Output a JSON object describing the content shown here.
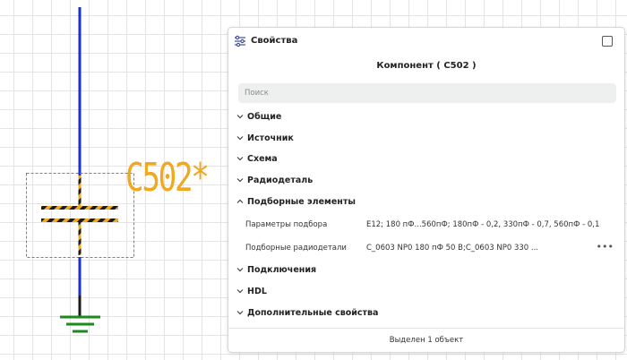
{
  "schematic": {
    "component_ref": "C502*",
    "colors": {
      "wire": "#1a2fd6",
      "lead": "#1a1a1a",
      "label": "#f0a81e",
      "ground": "#1d8a1d",
      "selection_box": "#b3713b"
    }
  },
  "panel": {
    "header_icon": "sliders-icon",
    "title": "Свойства",
    "component_title": "Компонент ( C502 )",
    "search_placeholder": "Поиск",
    "sections": [
      {
        "label": "Общие",
        "expanded": false
      },
      {
        "label": "Источник",
        "expanded": false
      },
      {
        "label": "Схема",
        "expanded": false
      },
      {
        "label": "Радиодеталь",
        "expanded": false
      },
      {
        "label": "Подборные элементы",
        "expanded": true
      },
      {
        "label": "Подключения",
        "expanded": false
      },
      {
        "label": "HDL",
        "expanded": false
      },
      {
        "label": "Дополнительные свойства",
        "expanded": false
      }
    ],
    "properties": [
      {
        "name": "Параметры подбора",
        "value": "E12; 180 пФ...560пФ; 180пФ - 0,2, 330пФ - 0,7, 560пФ - 0,1"
      },
      {
        "name": "Подборные радиодетали",
        "value": "C_0603 NP0 180 пФ 50 В;C_0603 NP0 330 ...",
        "more": "•••"
      }
    ],
    "footer": "Выделен 1 объект"
  }
}
